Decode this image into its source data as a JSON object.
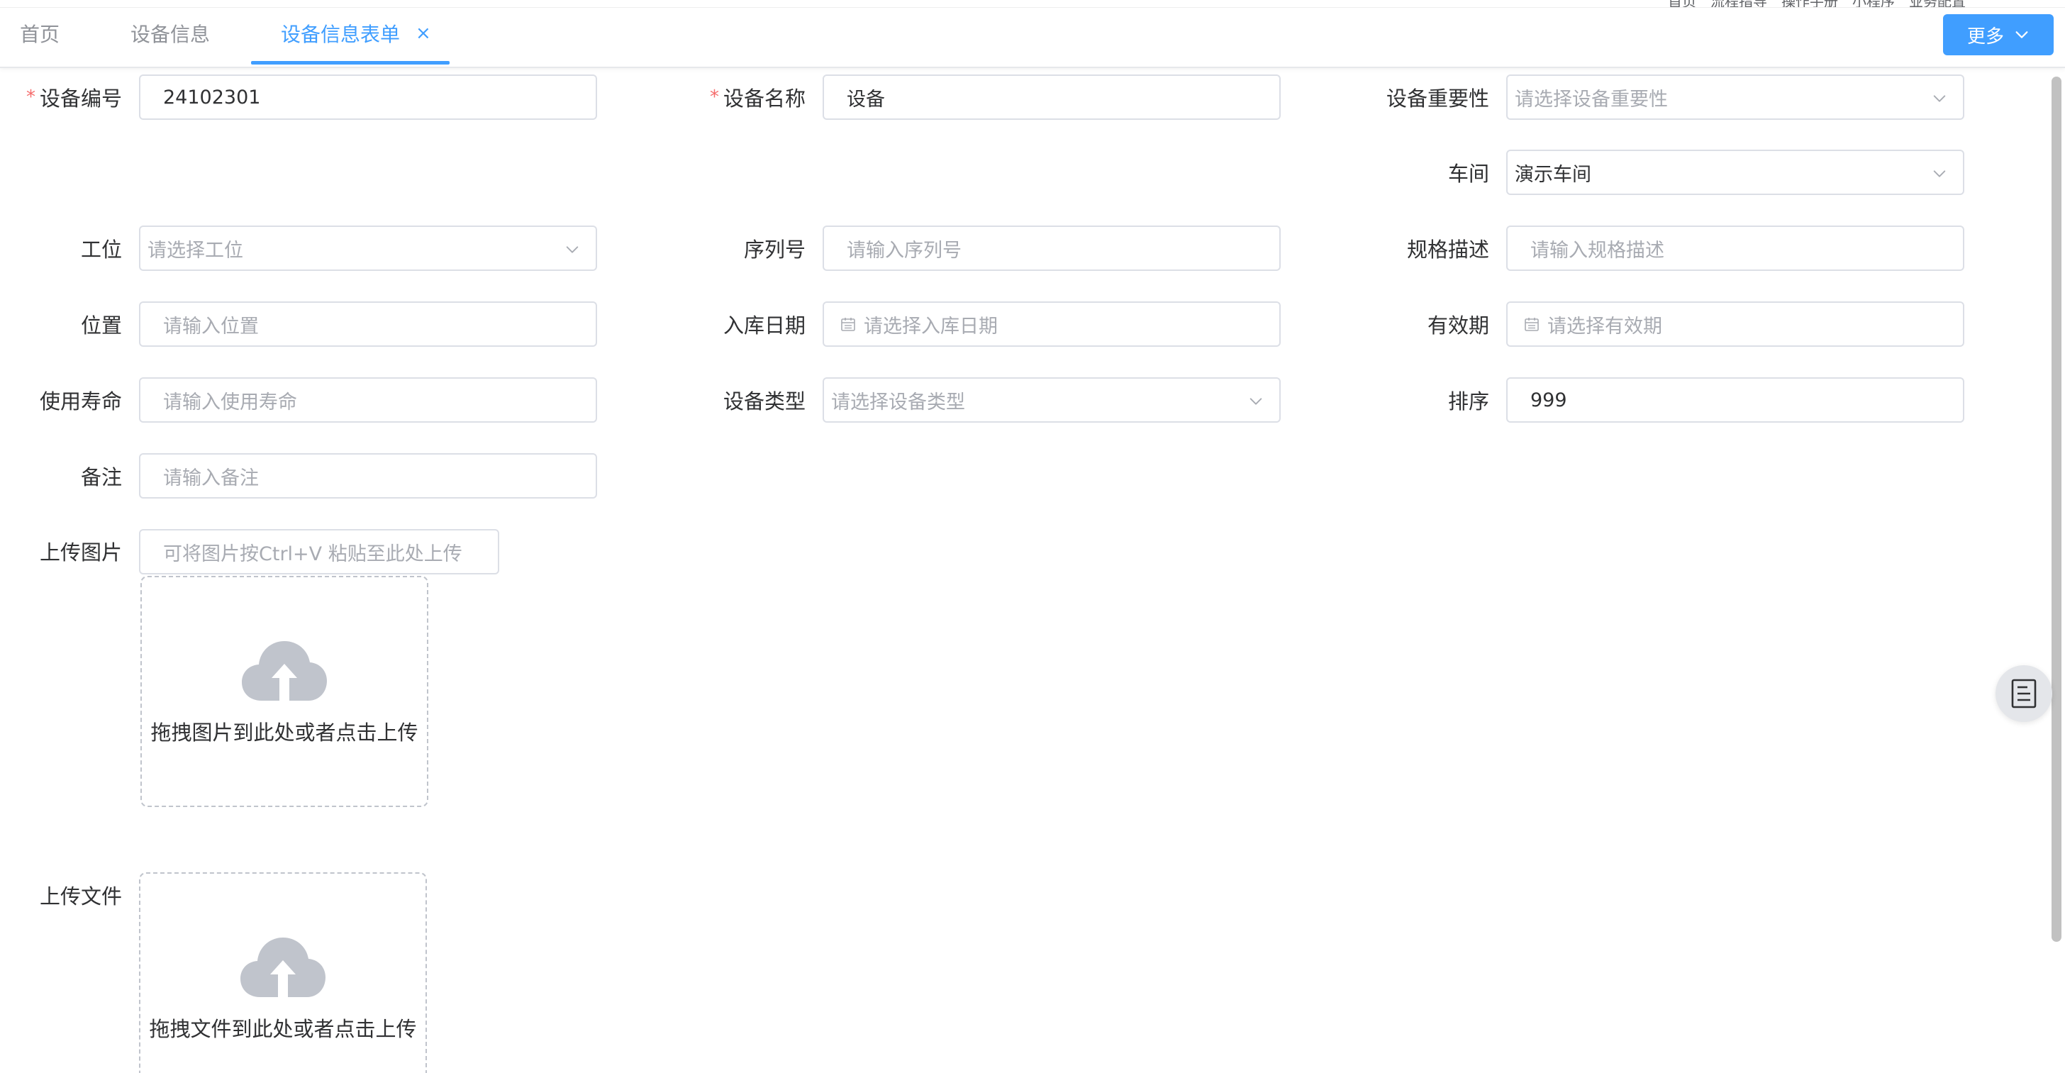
{
  "tabs": [
    {
      "label": "首页"
    },
    {
      "label": "设备信息"
    },
    {
      "label": "设备信息表单",
      "active": true,
      "close": "×"
    }
  ],
  "topnav": [
    "首页",
    "流程指导",
    "操作手册",
    "小程序",
    "业务配置"
  ],
  "more_button": {
    "label": "更多"
  },
  "form": {
    "device_code": {
      "label": "设备编号",
      "required": "*",
      "value": "24102301"
    },
    "device_name": {
      "label": "设备名称",
      "required": "*",
      "value": "设备"
    },
    "importance": {
      "label": "设备重要性",
      "placeholder": "请选择设备重要性"
    },
    "workshop": {
      "label": "车间",
      "value": "演示车间"
    },
    "station": {
      "label": "工位",
      "placeholder": "请选择工位"
    },
    "serial_no": {
      "label": "序列号",
      "placeholder": "请输入序列号"
    },
    "spec": {
      "label": "规格描述",
      "placeholder": "请输入规格描述"
    },
    "location": {
      "label": "位置",
      "placeholder": "请输入位置"
    },
    "storage_date": {
      "label": "入库日期",
      "placeholder": "请选择入库日期"
    },
    "validity": {
      "label": "有效期",
      "placeholder": "请选择有效期"
    },
    "lifespan": {
      "label": "使用寿命",
      "placeholder": "请输入使用寿命"
    },
    "device_type": {
      "label": "设备类型",
      "placeholder": "请选择设备类型"
    },
    "sort": {
      "label": "排序",
      "value": "999"
    },
    "remark": {
      "label": "备注",
      "placeholder": "请输入备注"
    },
    "upload_image": {
      "label": "上传图片",
      "paste_placeholder": "可将图片按Ctrl+V 粘贴至此处上传",
      "drop_text": "拖拽图片到此处或者点击上传"
    },
    "upload_file": {
      "label": "上传文件",
      "drop_text": "拖拽文件到此处或者点击上传"
    }
  },
  "colors": {
    "primary": "#409eff",
    "required": "#f56c6c",
    "placeholder": "#a8abb2",
    "border": "#dcdfe6"
  },
  "icons": {
    "select": "chevron-down-icon",
    "date": "calendar-icon",
    "upload": "cloud-upload-icon",
    "float": "document-icon"
  }
}
